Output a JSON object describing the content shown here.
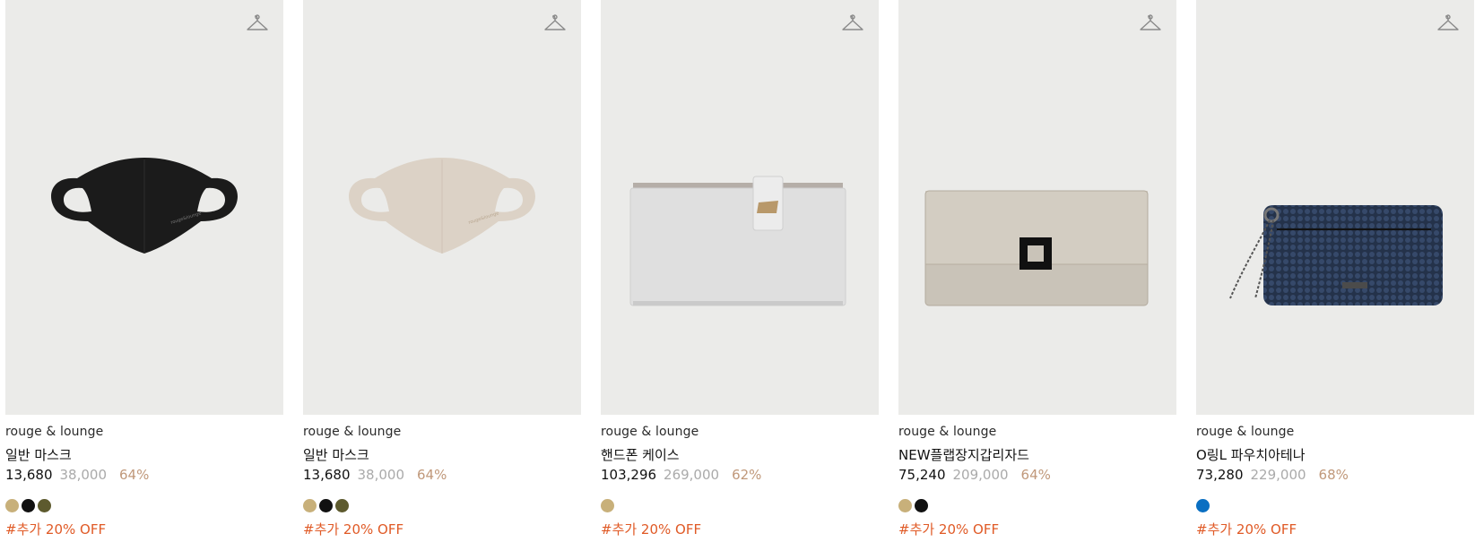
{
  "products": [
    {
      "brand": "rouge & lounge",
      "name": "일반 마스크",
      "price_sale": "13,680",
      "price_original": "38,000",
      "discount": "64%",
      "image": "black-face-mask",
      "colors": [
        "#c8b07a",
        "#111111",
        "#5d5a2e"
      ],
      "promo": "#추가 20% OFF"
    },
    {
      "brand": "rouge & lounge",
      "name": "일반 마스크",
      "price_sale": "13,680",
      "price_original": "38,000",
      "discount": "64%",
      "image": "beige-face-mask",
      "colors": [
        "#c8b07a",
        "#111111",
        "#5d5a2e"
      ],
      "promo": "#추가 20% OFF"
    },
    {
      "brand": "rouge & lounge",
      "name": "핸드폰 케이스",
      "price_sale": "103,296",
      "price_original": "269,000",
      "discount": "62%",
      "image": "white-phone-case-wallet",
      "colors": [
        "#c8b07a"
      ],
      "promo": "#추가 20% OFF"
    },
    {
      "brand": "rouge & lounge",
      "name": "NEW플랩장지갑리자드",
      "price_sale": "75,240",
      "price_original": "209,000",
      "discount": "64%",
      "image": "grey-lizard-flap-wallet",
      "colors": [
        "#c8b07a",
        "#111111"
      ],
      "promo": "#추가 20% OFF"
    },
    {
      "brand": "rouge & lounge",
      "name": "O링L 파우치아테나",
      "price_sale": "73,280",
      "price_original": "229,000",
      "discount": "68%",
      "image": "navy-quilted-pouch",
      "colors": [
        "#0a6fc2"
      ],
      "promo": "#추가 20% OFF"
    }
  ],
  "icons": {
    "wishlist": "hanger-icon"
  }
}
